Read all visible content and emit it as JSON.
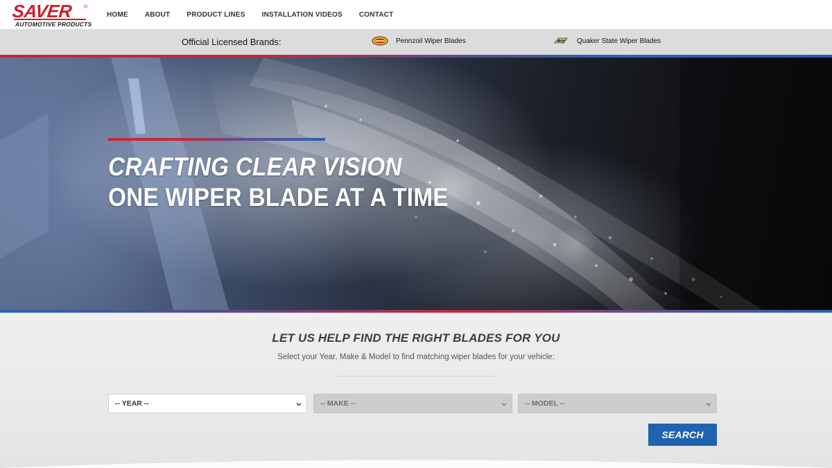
{
  "logo": {
    "name": "SAVER",
    "registered": "®",
    "tagline": "AUTOMOTIVE PRODUCTS"
  },
  "nav": {
    "items": [
      {
        "label": "HOME"
      },
      {
        "label": "ABOUT"
      },
      {
        "label": "PRODUCT LINES"
      },
      {
        "label": "INSTALLATION VIDEOS"
      },
      {
        "label": "CONTACT"
      }
    ]
  },
  "brands": {
    "title": "Official Licensed Brands:",
    "items": [
      {
        "label": "Pennzoil Wiper Blades",
        "icon": "pennzoil-logo-icon"
      },
      {
        "label": "Quaker State Wiper Blades",
        "icon": "quaker-state-logo-icon"
      }
    ]
  },
  "hero": {
    "line1": "CRAFTING CLEAR VISION",
    "line2": "ONE WIPER BLADE AT A TIME"
  },
  "finder": {
    "title": "LET US HELP FIND THE RIGHT BLADES FOR YOU",
    "subtitle": "Select your Year, Make & Model to find matching wiper blades for your vehicle:",
    "year": {
      "value": "-- YEAR --",
      "enabled": true
    },
    "make": {
      "value": "-- MAKE --",
      "enabled": false
    },
    "model": {
      "value": "-- MODEL --",
      "enabled": false
    },
    "search_label": "SEARCH"
  },
  "colors": {
    "brand_red": "#c8202f",
    "brand_blue": "#1e64ae",
    "stripe_purple": "#5b4a8a"
  }
}
